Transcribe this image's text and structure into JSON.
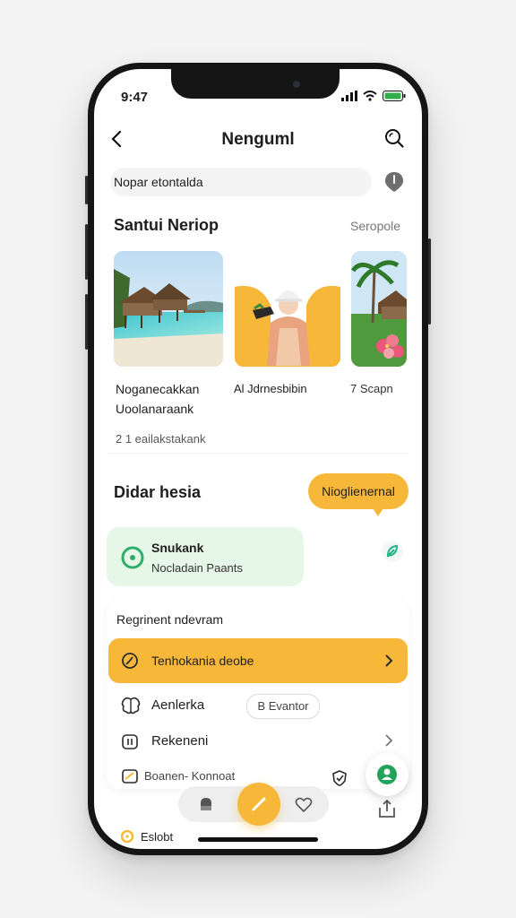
{
  "status": {
    "time": "9:47"
  },
  "header": {
    "title": "Nenguml"
  },
  "search": {
    "value": "Nopar etontalda"
  },
  "section1": {
    "title": "Santui Neriop",
    "link": "Seropole",
    "cards": [
      {
        "caption_line1": "Noganecakkan",
        "caption_line2": "Uoolanaraank"
      },
      {
        "caption_line1": "Al Jdrnesbibin"
      },
      {
        "caption_line1": "7 Scapn"
      }
    ],
    "meta": "2 1 eailakstakank"
  },
  "section2": {
    "title": "Didar hesia",
    "bubble": "Nioglienernal",
    "green_card": {
      "title": "Snukank",
      "subtitle": "Nocladain Paants"
    }
  },
  "list": {
    "heading": "Regrinent ndevram",
    "highlight_label": "Tenhokania deobe",
    "items": [
      {
        "label": "Aenlerka",
        "tag": "B Evantor"
      },
      {
        "label": "Rekeneni"
      },
      {
        "label": "Boanen-  Konnoat"
      }
    ]
  },
  "footer": {
    "label": "Eslobt"
  },
  "colors": {
    "accent": "#f7b83a",
    "green": "#2fae6b",
    "green_bg": "#e7f7e7"
  }
}
